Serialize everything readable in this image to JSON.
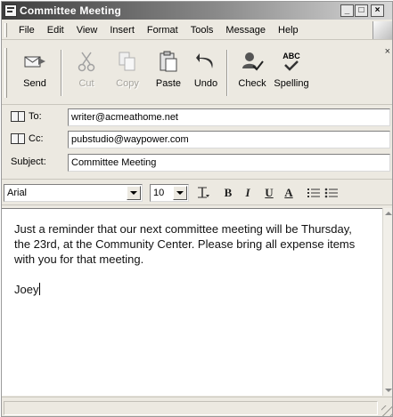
{
  "window": {
    "title": "Committee Meeting",
    "controls": {
      "minimize": "_",
      "maximize": "□",
      "close": "×"
    }
  },
  "menu": [
    "File",
    "Edit",
    "View",
    "Insert",
    "Format",
    "Tools",
    "Message",
    "Help"
  ],
  "toolbar": {
    "send": "Send",
    "cut": "Cut",
    "copy": "Copy",
    "paste": "Paste",
    "undo": "Undo",
    "check": "Check",
    "spelling": "Spelling",
    "spelling_icon_text": "ABC",
    "close_glyph": "×"
  },
  "headers": {
    "to_label": "To:",
    "to_value": "writer@acmeathome.net",
    "cc_label": "Cc:",
    "cc_value": "pubstudio@waypower.com",
    "subject_label": "Subject:",
    "subject_value": "Committee Meeting"
  },
  "format": {
    "font": "Arial",
    "size": "10",
    "bold": "B",
    "italic": "I",
    "underline": "U",
    "font_color": "A"
  },
  "message": {
    "paragraph1": "Just a reminder that our next committee meeting will be Thursday, the 23rd, at the Community Center. Please bring all expense items with you for that meeting.",
    "signature": "Joey"
  },
  "colors": {
    "title_gradient_start": "#3d3d3d",
    "window_bg": "#ece9e1",
    "accent_red": "#c0392b"
  }
}
